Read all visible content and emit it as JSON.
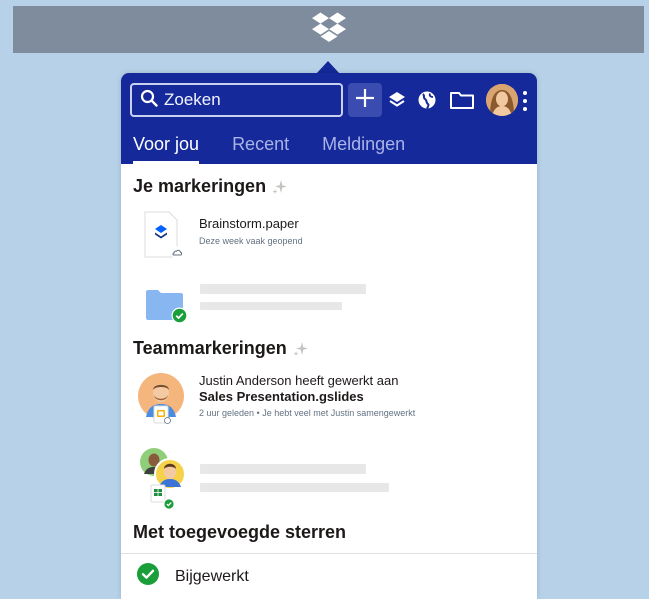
{
  "menubar": {
    "icon": "dropbox-logo-icon"
  },
  "header": {
    "search": {
      "placeholder": "Zoeken",
      "icon": "search-icon"
    },
    "actions": [
      "add-icon",
      "stack-icon",
      "globe-icon",
      "folder-icon"
    ],
    "avatar": "user-avatar",
    "colors": {
      "header": "#15299a",
      "accent": "#0061fe"
    }
  },
  "tabs": [
    {
      "label": "Voor jou",
      "active": true
    },
    {
      "label": "Recent",
      "active": false
    },
    {
      "label": "Meldingen",
      "active": false
    }
  ],
  "sections": {
    "mine": {
      "title": "Je markeringen"
    },
    "team": {
      "title": "Teammarkeringen"
    },
    "starred": {
      "title": "Met toegevoegde sterren"
    }
  },
  "mine_items": [
    {
      "name": "Brainstorm.paper",
      "meta": "Deze week vaak geopend",
      "icon": "paper-file-icon",
      "status": "cloud-icon"
    },
    {
      "placeholder": true,
      "icon": "folder-icon",
      "status": "synced-check-icon"
    }
  ],
  "team_items": [
    {
      "line1": "Justin Anderson heeft gewerkt aan",
      "name": "Sales Presentation.gslides",
      "meta": "2 uur geleden • Je hebt veel met Justin samengewerkt",
      "icon": "slides-file-icon"
    },
    {
      "placeholder": true,
      "icon": "sheets-file-icon",
      "status": "synced-check-icon"
    }
  ],
  "footer": {
    "status": "Bijgewerkt",
    "icon": "check-circle-icon"
  }
}
